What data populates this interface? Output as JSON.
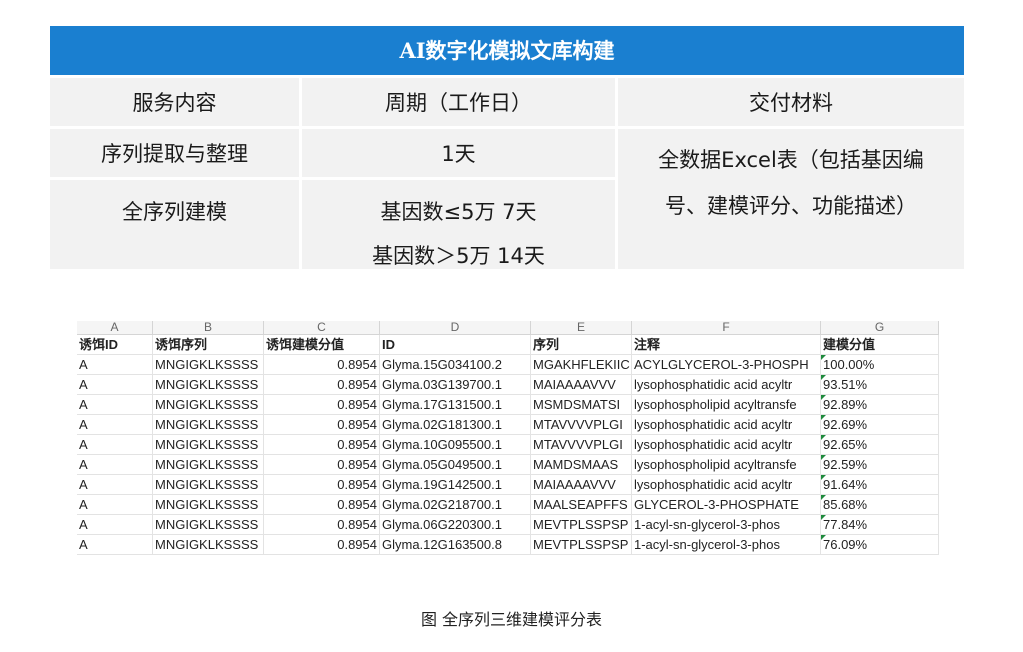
{
  "service_table": {
    "title": "AI数字化模拟文库构建",
    "headers": [
      "服务内容",
      "周期（工作日）",
      "交付材料"
    ],
    "row1": {
      "content": "序列提取与整理",
      "period": "1天"
    },
    "row2": {
      "content": "全序列建模",
      "period_line1": "基因数≤5万  7天",
      "period_line2": "基因数＞5万 14天"
    },
    "deliverable_line1": "全数据Excel表（包括基因编",
    "deliverable_line2": "号、建模评分、功能描述）"
  },
  "spreadsheet": {
    "columns": [
      "A",
      "B",
      "C",
      "D",
      "E",
      "F",
      "G"
    ],
    "headers": [
      "诱饵ID",
      "诱饵序列",
      "诱饵建模分值",
      "ID",
      "序列",
      "注释",
      "建模分值"
    ],
    "rows": [
      [
        "A",
        "MNGIGKLKSSSS",
        "0.8954",
        "Glyma.15G034100.2",
        "MGAKHFLEKIIC",
        "ACYLGLYCEROL-3-PHOSPH",
        "100.00%"
      ],
      [
        "A",
        "MNGIGKLKSSSS",
        "0.8954",
        "Glyma.03G139700.1",
        "MAIAAAAVVV",
        "lysophosphatidic acid acyltr",
        "93.51%"
      ],
      [
        "A",
        "MNGIGKLKSSSS",
        "0.8954",
        "Glyma.17G131500.1",
        "MSMDSMATSI",
        "lysophospholipid acyltransfe",
        "92.89%"
      ],
      [
        "A",
        "MNGIGKLKSSSS",
        "0.8954",
        "Glyma.02G181300.1",
        "MTAVVVVPLGI",
        "lysophosphatidic acid acyltr",
        "92.69%"
      ],
      [
        "A",
        "MNGIGKLKSSSS",
        "0.8954",
        "Glyma.10G095500.1",
        "MTAVVVVPLGI",
        "lysophosphatidic acid acyltr",
        "92.65%"
      ],
      [
        "A",
        "MNGIGKLKSSSS",
        "0.8954",
        "Glyma.05G049500.1",
        "MAMDSMAAS",
        "lysophospholipid acyltransfe",
        "92.59%"
      ],
      [
        "A",
        "MNGIGKLKSSSS",
        "0.8954",
        "Glyma.19G142500.1",
        "MAIAAAAVVV",
        "lysophosphatidic acid acyltr",
        "91.64%"
      ],
      [
        "A",
        "MNGIGKLKSSSS",
        "0.8954",
        "Glyma.02G218700.1",
        "MAALSEAPFFS",
        "GLYCEROL-3-PHOSPHATE",
        "85.68%"
      ],
      [
        "A",
        "MNGIGKLKSSSS",
        "0.8954",
        "Glyma.06G220300.1",
        "MEVTPLSSPSP",
        "1-acyl-sn-glycerol-3-phos",
        "77.84%"
      ],
      [
        "A",
        "MNGIGKLKSSSS",
        "0.8954",
        "Glyma.12G163500.8",
        "MEVTPLSSPSP",
        "1-acyl-sn-glycerol-3-phos",
        "76.09%"
      ]
    ]
  },
  "caption": "图  全序列三维建模评分表",
  "colors": {
    "title_bar": "#1a7fd0",
    "cell_bg": "#f2f2f2",
    "flag": "#1e8a3c"
  }
}
